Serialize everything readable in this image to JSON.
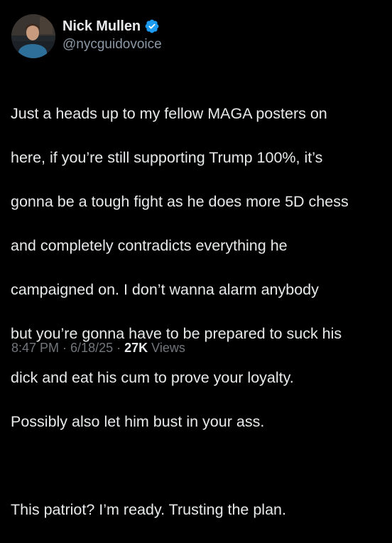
{
  "author": {
    "display_name": "Nick Mullen",
    "handle": "@nycguidovoice",
    "avatar": "profile-photo",
    "verified_icon": "verified-badge-icon",
    "verified_color": "#1d9bf0"
  },
  "tweet": {
    "paragraph1_lines": [
      "Just a heads up to my fellow MAGA posters on",
      "here, if you’re still supporting Trump 100%, it’s",
      "gonna be a tough fight as he does more 5D chess",
      "and completely contradicts everything he",
      "campaigned on. I don’t wanna alarm anybody",
      "but you’re gonna have to be prepared to suck his",
      "dick and eat his cum to prove your loyalty.",
      "Possibly also let him bust in your ass."
    ],
    "paragraph2": "This patriot? I’m ready. Trusting the plan."
  },
  "meta": {
    "time": "8:47 PM",
    "separator": "·",
    "date": "6/18/25",
    "views_count": "27K",
    "views_label": "Views"
  },
  "colors": {
    "background": "#000000",
    "text_primary": "#e7e9ea",
    "text_secondary": "#71767b"
  }
}
